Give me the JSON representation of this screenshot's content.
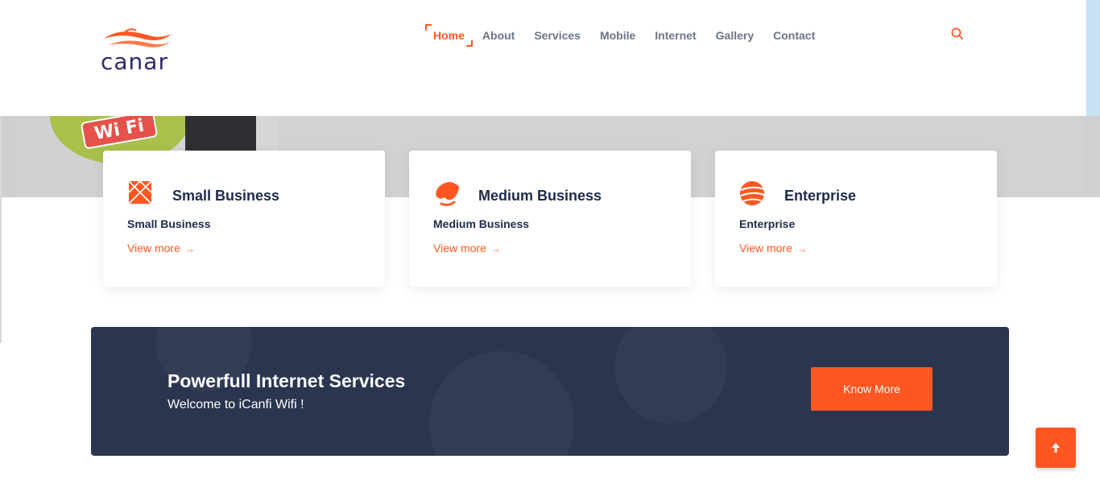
{
  "colors": {
    "accent": "#ff5722",
    "navy": "#1e2a4a",
    "banner_bg": "#2a3550",
    "nav_text": "#6b7488"
  },
  "logo": {
    "text": "canar",
    "icon": "wave-logo"
  },
  "nav": {
    "items": [
      {
        "label": "Home",
        "active": true
      },
      {
        "label": "About"
      },
      {
        "label": "Services"
      },
      {
        "label": "Mobile"
      },
      {
        "label": "Internet"
      },
      {
        "label": "Gallery"
      },
      {
        "label": "Contact"
      }
    ],
    "search_icon": "search-icon"
  },
  "hero": {
    "wifi_badge": "Wi Fi"
  },
  "cards": [
    {
      "icon": "cross-box-icon",
      "title": "Small Business",
      "subtitle": "Small Business",
      "link": "View more",
      "arrow": "→"
    },
    {
      "icon": "swirl-icon",
      "title": "Medium Business",
      "subtitle": "Medium Business",
      "link": "View more",
      "arrow": "→"
    },
    {
      "icon": "globe-stripes-icon",
      "title": "Enterprise",
      "subtitle": "Enterprise",
      "link": "View more",
      "arrow": "→"
    }
  ],
  "banner": {
    "title": "Powerfull Internet Services",
    "subtitle": "Welcome to iCanfi Wifi !",
    "button": "Know More"
  },
  "back_to_top": {
    "icon": "arrow-up-icon"
  }
}
